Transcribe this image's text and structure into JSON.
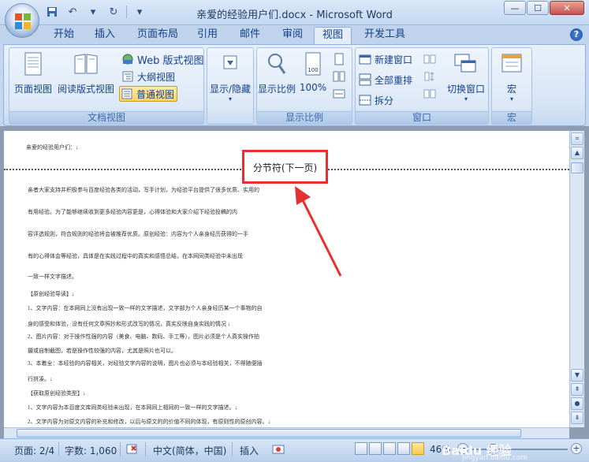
{
  "window": {
    "title": "亲爱的经验用户们.docx - Microsoft Word",
    "minimize": "—",
    "maximize": "☐",
    "close": "✕"
  },
  "qat": {
    "save_icon": "save-icon",
    "undo_icon": "undo-icon",
    "redo_icon": "redo-icon",
    "dropdown_icon": "dropdown-icon"
  },
  "tabs": [
    {
      "label": "开始"
    },
    {
      "label": "插入"
    },
    {
      "label": "页面布局"
    },
    {
      "label": "引用"
    },
    {
      "label": "邮件"
    },
    {
      "label": "审阅"
    },
    {
      "label": "视图",
      "active": true
    },
    {
      "label": "开发工具"
    }
  ],
  "ribbon": {
    "doc_views": {
      "label": "文档视图",
      "page_view": "页面视图",
      "reading_view": "阅读版式视图",
      "web_view": "Web 版式视图",
      "outline_view": "大纲视图",
      "draft_view": "普通视图"
    },
    "show_hide": {
      "label": "显示/隐藏"
    },
    "zoom": {
      "label": "显示比例",
      "zoom_btn": "显示比例",
      "hundred": "100%"
    },
    "window": {
      "label": "窗口",
      "new_window": "新建窗口",
      "arrange_all": "全部重排",
      "split": "拆分",
      "switch_windows": "切换窗口"
    },
    "macros": {
      "label": "宏",
      "macro_btn": "宏"
    }
  },
  "document": {
    "line0": "亲爱的经验用户们：↓",
    "section_break_label": "分节符(下一页)",
    "lines": [
      "亲者大家支持并积极参与百度经验各类的活动，写手计划，为经验平台提供了很多优质、实用的",
      "有用经验。为了能够继续收到更多经验内容更是，心得体验和大家介绍下经验投稿的内",
      "容评选规则，符合规则的经验将会被推荐优质。原创经验：内容为个人亲身经历获得的一手",
      "有的心得体会等经验，具体是在实践过程中的真实和感悟总结，在本网同类经验中未出现",
      "一致一样文字描述。",
      "【原创经验导读】↓",
      "1、文字内容：在本网同上没有出现一致一样的文字描述，文字部为个人亲身经历某一个事物的自",
      "身的感受和体验，没有任何文章照抄和形式改写的情况，真实反映自身实践的情况 ↓",
      "2、图片内容：对于操作性强的内容（美食、电脑、数码、手工等），图片必须是个人真实操作拍",
      "摄或自制截图，若是操作性较强的内容，尤其是照片也可以。",
      "3、本着全：本经验的内容相关，对经验文字内容的说明，图片也必须与本经验相关，不得随便插",
      "行拼凑。↓",
      "【获取原创经验类型】↓",
      "1、文字内容为本百度文库同类经验未出现，在本网同上相同的一致一样的文字描述。↓",
      "2、文字内容为对原文内容的补充和修改，以后与原文的的价值不同的体现，有原则性的原创内容。↓"
    ]
  },
  "statusbar": {
    "page": "页面: 2/4",
    "words": "字数: 1,060",
    "language": "中文(简体，中国)",
    "insert": "插入",
    "zoom": "46%"
  },
  "watermark": {
    "main": "Baidu 经验",
    "sub": "jingyan.baidu.com"
  }
}
